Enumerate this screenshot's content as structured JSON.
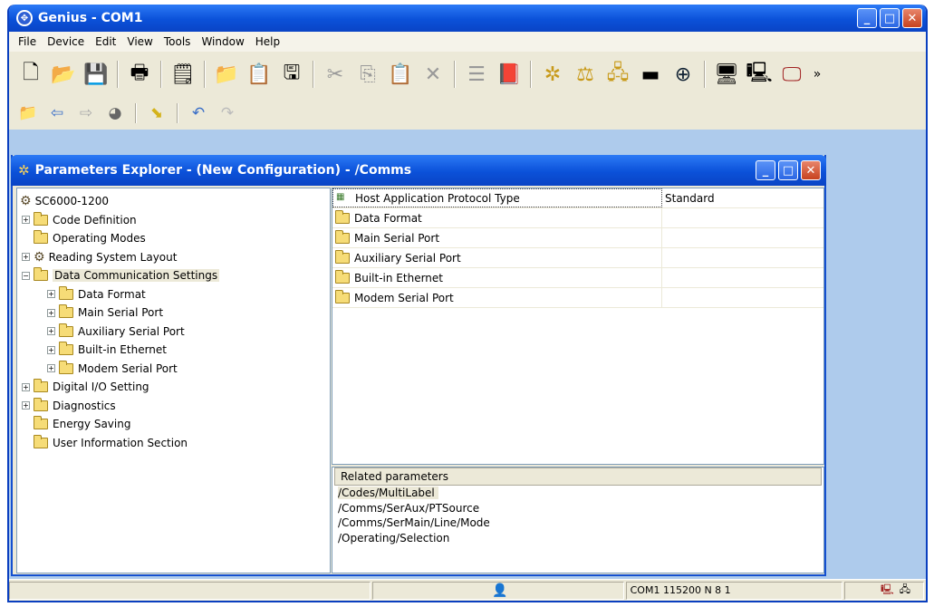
{
  "app": {
    "title": "Genius - COM1"
  },
  "menu": [
    "File",
    "Device",
    "Edit",
    "View",
    "Tools",
    "Window",
    "Help"
  ],
  "toolbar_more": "»",
  "child": {
    "title": "Parameters Explorer - (New Configuration) - /Comms"
  },
  "tree": {
    "root": "SC6000-1200",
    "items": [
      {
        "label": "Code Definition"
      },
      {
        "label": "Operating Modes"
      },
      {
        "label": "Reading System Layout"
      },
      {
        "label": "Data Communication Settings"
      },
      {
        "label": "Data Format"
      },
      {
        "label": "Main Serial Port"
      },
      {
        "label": "Auxiliary Serial Port"
      },
      {
        "label": "Built-in Ethernet"
      },
      {
        "label": "Modem Serial Port"
      },
      {
        "label": "Digital I/O Setting"
      },
      {
        "label": "Diagnostics"
      },
      {
        "label": "Energy Saving"
      },
      {
        "label": "User Information Section"
      }
    ]
  },
  "grid": {
    "rows": [
      {
        "name": "Host Application Protocol Type",
        "value": "Standard"
      },
      {
        "name": "Data Format",
        "value": ""
      },
      {
        "name": "Main Serial Port",
        "value": ""
      },
      {
        "name": "Auxiliary Serial Port",
        "value": ""
      },
      {
        "name": "Built-in Ethernet",
        "value": ""
      },
      {
        "name": "Modem Serial Port",
        "value": ""
      }
    ]
  },
  "related": {
    "header": "Related parameters",
    "items": [
      "/Codes/MultiLabel",
      "/Comms/SerAux/PTSource",
      "/Comms/SerMain/Line/Mode",
      "/Operating/Selection"
    ]
  },
  "status": {
    "connection": "COM1 115200 N 8 1"
  }
}
